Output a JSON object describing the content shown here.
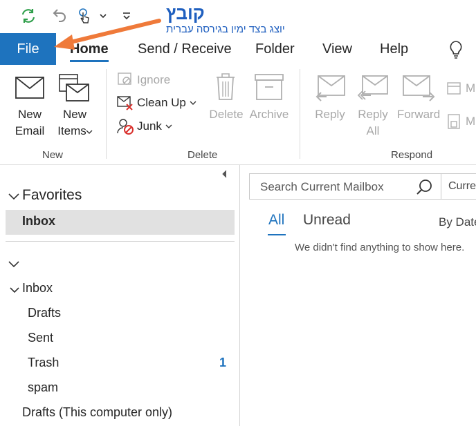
{
  "annotation": {
    "brand": "קובץ",
    "subtitle": "יוצג בצד ימין בגירסה עברית"
  },
  "tabs": {
    "file": "File",
    "home": "Home",
    "send_receive": "Send / Receive",
    "folder": "Folder",
    "view": "View",
    "help": "Help"
  },
  "ribbon": {
    "new_email": [
      "New",
      "Email"
    ],
    "new_items": [
      "New",
      "Items"
    ],
    "ignore": "Ignore",
    "clean_up": "Clean Up",
    "junk": "Junk",
    "delete": "Delete",
    "archive": "Archive",
    "reply": "Reply",
    "reply_all": [
      "Reply",
      "All"
    ],
    "forward": "Forward",
    "more_1": "M",
    "more_2": "M",
    "groups": {
      "new": "New",
      "delete": "Delete",
      "respond": "Respond"
    }
  },
  "nav": {
    "favorites": "Favorites",
    "fav_inbox": "Inbox",
    "inbox": "Inbox",
    "folders": [
      {
        "name": "Drafts",
        "count": ""
      },
      {
        "name": "Sent",
        "count": ""
      },
      {
        "name": "Trash",
        "count": "1"
      },
      {
        "name": "spam",
        "count": ""
      }
    ],
    "local_drafts": "Drafts (This computer only)"
  },
  "mail": {
    "search_placeholder": "Search Current Mailbox",
    "scope": "Curre",
    "filter_all": "All",
    "filter_unread": "Unread",
    "sort": "By Date",
    "empty_message": "We didn't find anything to show here."
  },
  "colors": {
    "accent": "#1e73be",
    "arrow": "#ef7a3a",
    "annotation": "#1f5fbf",
    "refresh": "#2e9e4a"
  }
}
